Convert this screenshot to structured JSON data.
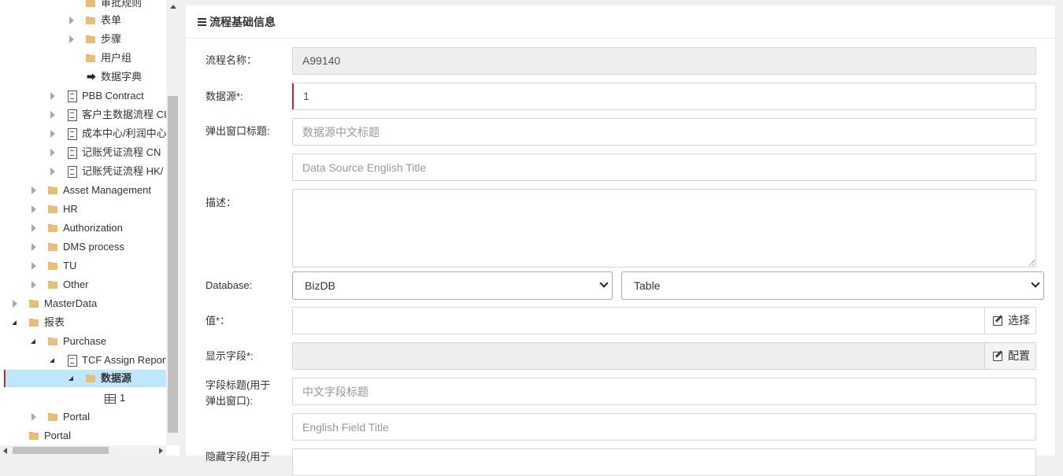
{
  "tree": {
    "items": [
      {
        "label": "审批规则",
        "type": "folder",
        "arrow": "none"
      },
      {
        "label": "表单",
        "type": "folder",
        "arrow": "right"
      },
      {
        "label": "步骤",
        "type": "folder",
        "arrow": "right"
      },
      {
        "label": "用户组",
        "type": "folder",
        "arrow": "none"
      },
      {
        "label": "数据字典",
        "type": "signin",
        "arrow": "none"
      },
      {
        "label": "PBB Contract",
        "type": "doc",
        "arrow": "right"
      },
      {
        "label": "客户主数据流程 CI",
        "type": "doc",
        "arrow": "right"
      },
      {
        "label": "成本中心/利润中心",
        "type": "doc",
        "arrow": "right"
      },
      {
        "label": "记账凭证流程 CN",
        "type": "doc",
        "arrow": "right"
      },
      {
        "label": "记账凭证流程 HK/",
        "type": "doc",
        "arrow": "right"
      },
      {
        "label": "Asset Management",
        "type": "folder",
        "arrow": "right"
      },
      {
        "label": "HR",
        "type": "folder",
        "arrow": "right"
      },
      {
        "label": "Authorization",
        "type": "folder",
        "arrow": "right"
      },
      {
        "label": "DMS process",
        "type": "folder",
        "arrow": "right"
      },
      {
        "label": "TU",
        "type": "folder",
        "arrow": "right"
      },
      {
        "label": "Other",
        "type": "folder",
        "arrow": "right"
      },
      {
        "label": "MasterData",
        "type": "folder",
        "arrow": "right"
      },
      {
        "label": "报表",
        "type": "folder",
        "arrow": "down"
      },
      {
        "label": "Purchase",
        "type": "folder",
        "arrow": "down"
      },
      {
        "label": "TCF Assign Report",
        "type": "doc",
        "arrow": "down"
      },
      {
        "label": "数据源",
        "type": "folder",
        "arrow": "down",
        "selected": true
      },
      {
        "label": "1",
        "type": "table",
        "arrow": "none"
      },
      {
        "label": "Portal",
        "type": "folder",
        "arrow": "right"
      },
      {
        "label": "Portal",
        "type": "folder",
        "arrow": "none"
      }
    ]
  },
  "panel": {
    "title": "流程基础信息"
  },
  "form": {
    "process_name_label": "流程名称：",
    "process_name_value": "A99140",
    "datasource_label": "数据源*:",
    "datasource_value": "1",
    "popup_title_label": "弹出窗口标题:",
    "popup_title_cn_placeholder": "数据源中文标题",
    "popup_title_en_placeholder": "Data Source English Title",
    "description_label": "描述：",
    "description_value": "",
    "database_label": "Database:",
    "database_value": "BizDB",
    "table_value": "Table",
    "value_label": "值*：",
    "value_value": "",
    "select_button_label": "选择",
    "display_field_label": "显示字段*:",
    "display_field_value": "",
    "config_button_label": "配置",
    "field_title_label_line1": "字段标题(用于",
    "field_title_label_line2": "弹出窗口):",
    "field_title_cn_placeholder": "中文字段标题",
    "field_title_en_placeholder": "English Field Title",
    "hidden_field_label_partial": "隐藏字段(用于"
  }
}
